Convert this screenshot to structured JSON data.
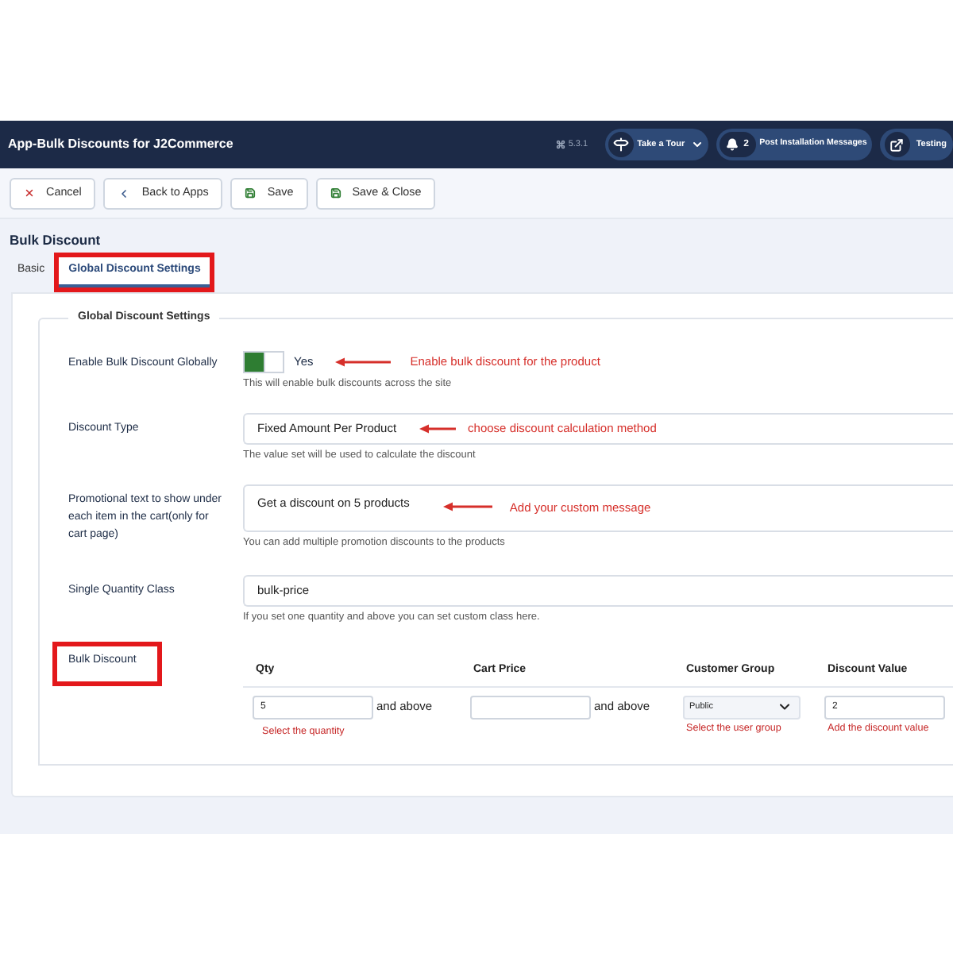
{
  "header": {
    "title": "App-Bulk Discounts for J2Commerce",
    "version": "5.3.1",
    "actions": [
      {
        "kind": "tour",
        "label": "Take a Tour"
      },
      {
        "kind": "messages",
        "count": "2",
        "label": "Post Installation Messages"
      },
      {
        "kind": "link",
        "label": "Testing"
      }
    ]
  },
  "toolbar": [
    {
      "kind": "cancel",
      "label": "Cancel"
    },
    {
      "kind": "back",
      "label": "Back to Apps"
    },
    {
      "kind": "save",
      "label": "Save"
    },
    {
      "kind": "save_close",
      "label": "Save & Close"
    }
  ],
  "page_title": "Bulk Discount",
  "tabs": [
    {
      "label": "Basic",
      "selected": false,
      "highlighted": false
    },
    {
      "label": "Global Discount Settings",
      "selected": true,
      "highlighted": true
    }
  ],
  "fieldset": {
    "legend": "Global Discount Settings",
    "fields": [
      {
        "kind": "switch",
        "label": "Enable Bulk Discount Globally",
        "highlighted": false,
        "on": true,
        "value": "Yes",
        "help": "This will enable bulk discounts across the site",
        "annotation": "Enable bulk discount for the product"
      },
      {
        "kind": "text",
        "label": "Discount Type",
        "highlighted": false,
        "value": "Fixed Amount Per Product",
        "help": "The value set will be used to calculate the discount",
        "annotation": "choose discount calculation method"
      },
      {
        "kind": "textarea",
        "label": "Promotional text to show under each item in the cart(only for cart page)",
        "highlighted": false,
        "value": "Get a discount on 5 products",
        "help": "You can add multiple promotion discounts to the products",
        "annotation": "Add your custom message"
      },
      {
        "kind": "text",
        "label": "Single Quantity Class",
        "highlighted": false,
        "value": "bulk-price",
        "help": "If you set one quantity and above you can set custom class here."
      },
      {
        "kind": "table",
        "label": "Bulk Discount",
        "highlighted": true,
        "columns": [
          "Qty",
          "Cart Price",
          "Customer Group",
          "Discount Value"
        ],
        "rows": [
          [
            {
              "kind": "input",
              "value": "5",
              "suffix": "and above",
              "help": "Select the quantity"
            },
            {
              "kind": "input",
              "suffix": "and above"
            },
            {
              "kind": "select",
              "value": "Public",
              "help": "Select the user group"
            },
            {
              "kind": "input",
              "value": "2",
              "help": "Add the discount value"
            }
          ]
        ]
      }
    ]
  }
}
